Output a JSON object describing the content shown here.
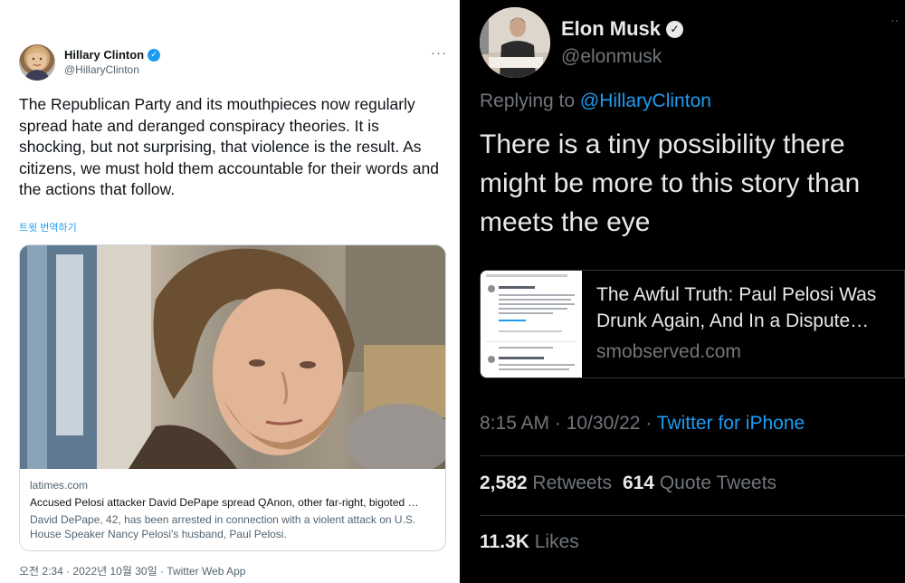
{
  "left_tweet": {
    "author_name": "Hillary Clinton",
    "author_handle": "@HillaryClinton",
    "more_label": "···",
    "text": "The Republican Party and its mouthpieces now regularly spread hate and deranged conspiracy theories. It is shocking, but not surprising, that violence is the result. As citizens, we must hold them accountable for their words and the actions that follow.",
    "translate_label": "트윗 번역하기",
    "card": {
      "domain": "latimes.com",
      "title": "Accused Pelosi attacker David DePape spread QAnon, other far-right, bigoted …",
      "description": "David DePape, 42, has been arrested in connection with a violent attack on U.S. House Speaker Nancy Pelosi's husband, Paul Pelosi."
    },
    "meta": "오전 2:34 · 2022년 10월 30일 · Twitter Web App",
    "colors": {
      "verified": "#1d9bf0",
      "link": "#1d9bf0",
      "secondary_text": "#536471"
    }
  },
  "right_tweet": {
    "author_name": "Elon Musk",
    "author_handle": "@elonmusk",
    "more_label": "··",
    "replying_prefix": "Replying to",
    "replying_mention": "@HillaryClinton",
    "text": "There is a tiny possibility there might be more to this story than meets the eye",
    "card": {
      "title_line1": "The Awful Truth: Paul Pelosi Was",
      "title_line2": "Drunk Again, And In a Dispute…",
      "domain": "smobserved.com"
    },
    "meta_time": "8:15 AM · 10/30/22 ·",
    "meta_source": "Twitter for iPhone",
    "retweets_count": "2,582",
    "retweets_label": "Retweets",
    "quote_count": "614",
    "quote_label": "Quote Tweets",
    "likes_count": "11.3K",
    "likes_label": "Likes",
    "colors": {
      "background": "#000000",
      "link": "#1d9bf0",
      "secondary_text": "#71767b"
    }
  },
  "icons": {
    "verified": "verified-badge-icon",
    "more": "more-options-icon"
  }
}
